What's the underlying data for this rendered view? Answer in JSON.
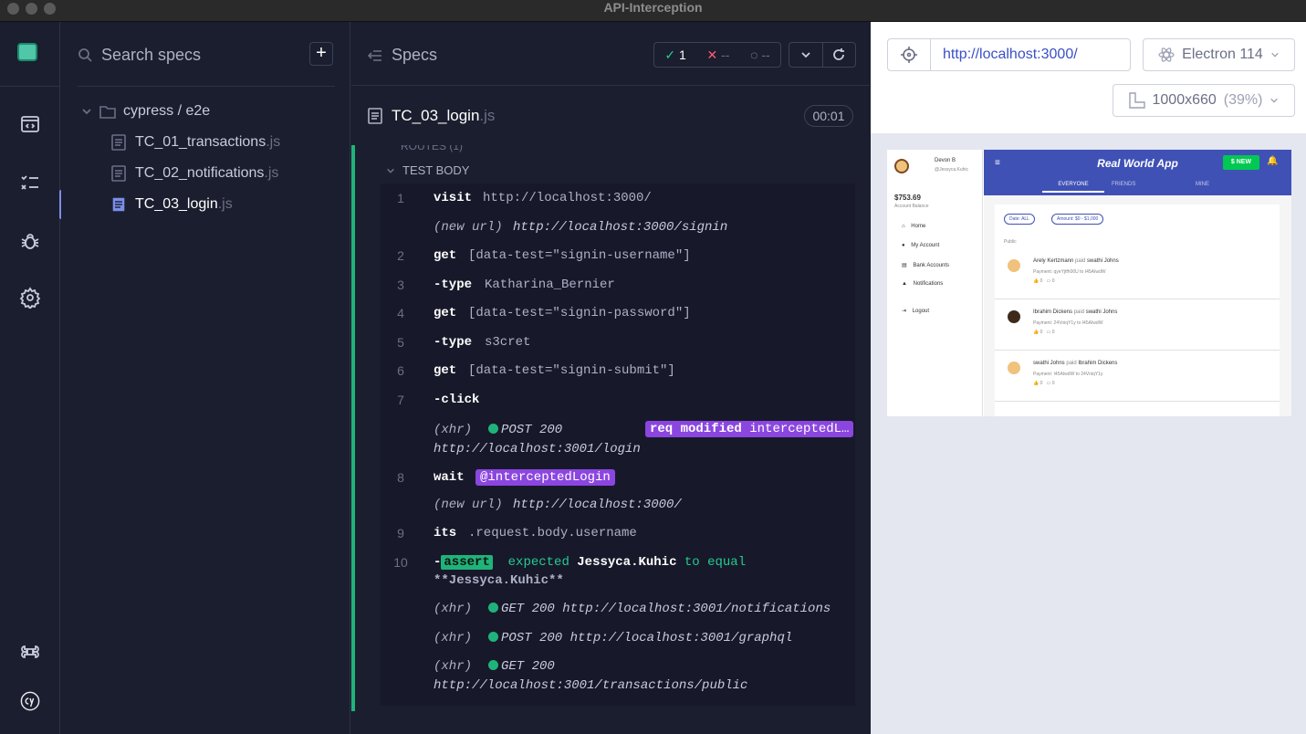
{
  "window": {
    "title": "API-Interception"
  },
  "colors": {
    "accent_green": "#1fb37a",
    "accent_purple": "#8b46e0",
    "app_blue": "#3f51b5"
  },
  "sidebar": {
    "icons": [
      "specs-list-icon",
      "runs-icon",
      "debug-bug-icon",
      "settings-gear-icon",
      "keyboard-shortcuts-icon",
      "cypress-logo-icon"
    ]
  },
  "specs": {
    "search_placeholder": "Search specs",
    "add_label": "+",
    "folder": "cypress / e2e",
    "files": [
      {
        "name": "TC_01_transactions",
        "ext": ".js"
      },
      {
        "name": "TC_02_notifications",
        "ext": ".js"
      },
      {
        "name": "TC_03_login",
        "ext": ".js"
      }
    ]
  },
  "reporter": {
    "title": "Specs",
    "passed": "1",
    "failed": "--",
    "pending": "--",
    "file": {
      "name": "TC_03_login",
      "ext": ".js"
    },
    "duration": "00:01",
    "routes_label": "ROUTES (1)",
    "test_body_label": "TEST BODY",
    "commands": {
      "c1": {
        "num": "1",
        "name": "visit",
        "msg": "http://localhost:3000/"
      },
      "c1b": {
        "prefix": "(new url)",
        "msg": "http://localhost:3000/signin"
      },
      "c2": {
        "num": "2",
        "name": "get",
        "msg": "[data-test=\"signin-username\"]"
      },
      "c3": {
        "num": "3",
        "name": "-type",
        "msg": "Katharina_Bernier"
      },
      "c4": {
        "num": "4",
        "name": "get",
        "msg": "[data-test=\"signin-password\"]"
      },
      "c5": {
        "num": "5",
        "name": "-type",
        "msg": "s3cret"
      },
      "c6": {
        "num": "6",
        "name": "get",
        "msg": "[data-test=\"signin-submit\"]"
      },
      "c7": {
        "num": "7",
        "name": "-click",
        "msg": ""
      },
      "x1": {
        "prefix": "(xhr)",
        "method": "POST 200",
        "url": "http://localhost:3001/login",
        "badge_bold": "req modified",
        "badge_rest": "interceptedL…"
      },
      "c8": {
        "num": "8",
        "name": "wait",
        "alias": "@interceptedLogin"
      },
      "c8b": {
        "prefix": "(new url)",
        "msg": "http://localhost:3000/"
      },
      "c9": {
        "num": "9",
        "name": "its",
        "msg": ".request.body.username"
      },
      "c10": {
        "num": "10",
        "dash": "-",
        "badge": "assert",
        "expected": "expected",
        "actual": "Jessyca.Kuhic",
        "to_equal": "to equal",
        "value": "**Jessyca.Kuhic**"
      },
      "x2": {
        "prefix": "(xhr)",
        "text": "GET 200 http://localhost:3001/notifications"
      },
      "x3": {
        "prefix": "(xhr)",
        "text": "POST 200 http://localhost:3001/graphql"
      },
      "x4": {
        "prefix": "(xhr)",
        "method": "GET 200",
        "url": "http://localhost:3001/transactions/public"
      }
    }
  },
  "browser": {
    "url": "http://localhost:3000/",
    "browser_name": "Electron 114",
    "viewport": "1000x660",
    "viewport_pct": "(39%)"
  },
  "app": {
    "user_name": "Devon B",
    "user_handle": "@Jessyca.Kuhic",
    "balance": "$753.69",
    "balance_label": "Account Balance",
    "nav": [
      "Home",
      "My Account",
      "Bank Accounts",
      "Notifications",
      "Logout"
    ],
    "title": "Real World App",
    "new_button": "$ NEW",
    "tabs": [
      "EVERYONE",
      "FRIENDS",
      "MINE"
    ],
    "filters": [
      "Date: ALL",
      "Amount: $0 - $1,000"
    ],
    "public_label": "Public",
    "feed": [
      {
        "a": "Arely Kertzmann",
        "verb": "paid",
        "b": "swathi Johns",
        "payment": "Payment: qyeYjtfh00U to I45AIwdW"
      },
      {
        "a": "Ibrahim Dickens",
        "verb": "paid",
        "b": "swathi Johns",
        "payment": "Payment: 24VniqY1y to I45AIwdW"
      },
      {
        "a": "swathi Johns",
        "verb": "paid",
        "b": "Ibrahim Dickens",
        "payment": "Payment: I45AIwdW to 24VniqY1y"
      }
    ],
    "likes": "0",
    "comments": "0"
  }
}
